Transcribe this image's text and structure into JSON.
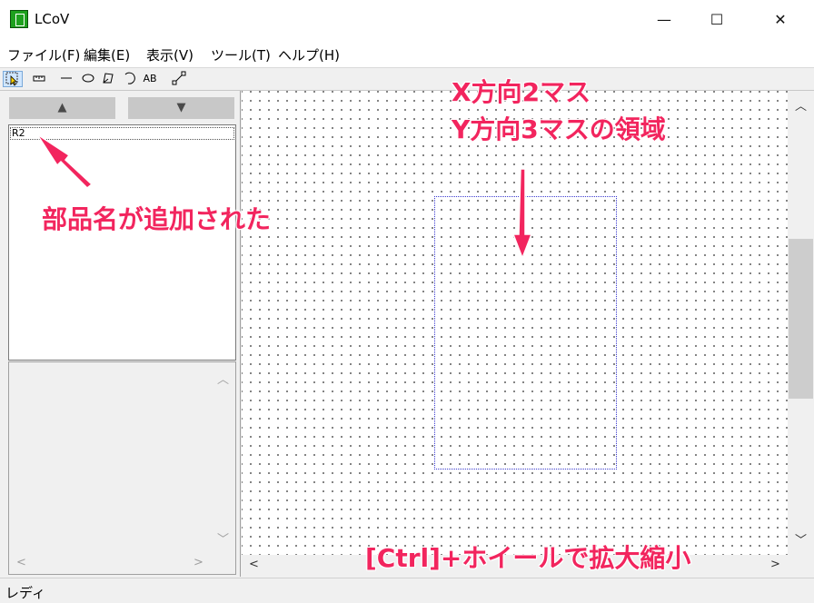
{
  "window": {
    "title": "LCoV",
    "minimize_glyph": "—",
    "maximize_glyph": "☐",
    "close_glyph": "✕"
  },
  "menu": [
    "ファイル(F)",
    "編集(E)",
    "表示(V)",
    "ツール(T)",
    "ヘルプ(H)"
  ],
  "toolbar": {
    "tools": [
      "select",
      "ruler",
      "line",
      "ellipse",
      "polygon",
      "arc",
      "text",
      "wire"
    ],
    "text_tool_label": "AB"
  },
  "left_panel": {
    "up_glyph": "▲",
    "down_glyph": "▼",
    "parts": [
      "R2"
    ]
  },
  "status": {
    "text": "レディ"
  },
  "annotations": {
    "region_line1": "X方向2マス",
    "region_line2": "Y方向3マスの領域",
    "part_added": "部品名が追加された",
    "zoom_hint": "[Ctrl]+ホイールで拡大縮小",
    "color": "#f2255e"
  }
}
